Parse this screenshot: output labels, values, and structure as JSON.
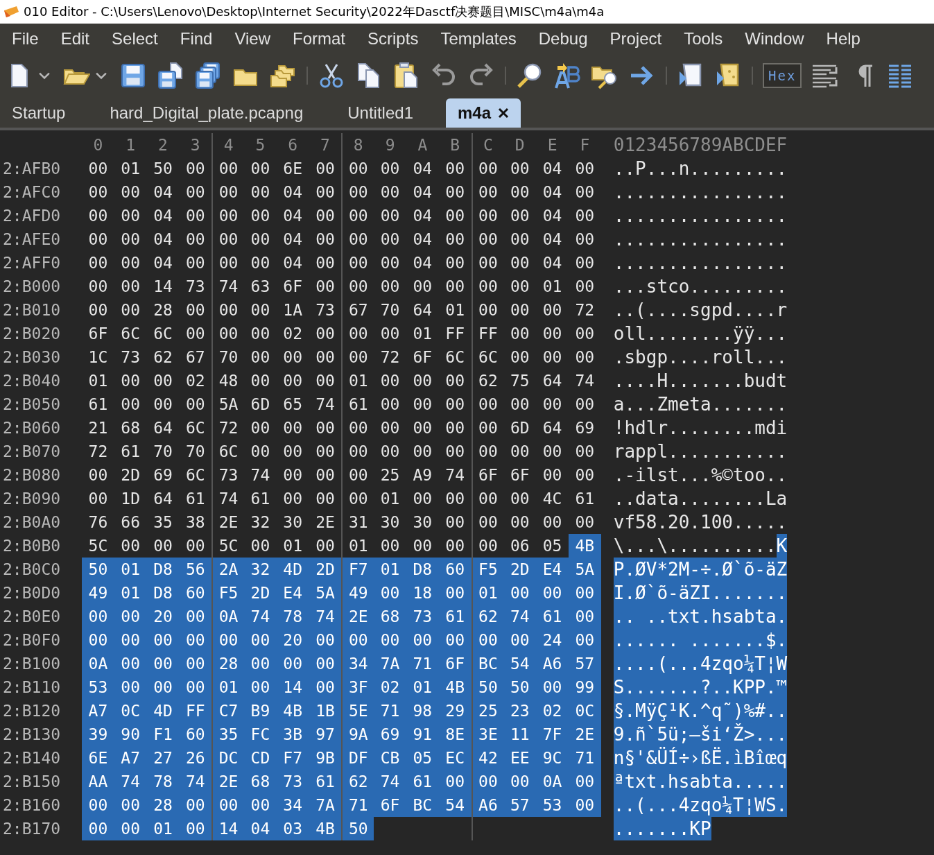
{
  "window": {
    "title": "010 Editor - C:\\Users\\Lenovo\\Desktop\\Internet Security\\2022年Dasctf决赛题目\\MISC\\m4a\\m4a"
  },
  "menu": [
    "File",
    "Edit",
    "Select",
    "Find",
    "View",
    "Format",
    "Scripts",
    "Templates",
    "Debug",
    "Project",
    "Tools",
    "Window",
    "Help"
  ],
  "toolbar": {
    "hex_toggle": {
      "label": "Hex",
      "on": true
    }
  },
  "tabs": [
    {
      "label": "Startup",
      "selected": false
    },
    {
      "label": "hard_Digital_plate.pcapng",
      "selected": false
    },
    {
      "label": "Untitled1",
      "selected": false
    },
    {
      "label": "m4a",
      "selected": true
    }
  ],
  "hex_view": {
    "column_headers": [
      "0",
      "1",
      "2",
      "3",
      "4",
      "5",
      "6",
      "7",
      "8",
      "9",
      "A",
      "B",
      "C",
      "D",
      "E",
      "F"
    ],
    "ascii_header": "0123456789ABCDEF",
    "rows": [
      {
        "address": "2:AFB0",
        "bytes": [
          "00",
          "01",
          "50",
          "00",
          "00",
          "00",
          "6E",
          "00",
          "00",
          "00",
          "04",
          "00",
          "00",
          "00",
          "04",
          "00"
        ],
        "selected_bytes": [],
        "ascii": "..P...n.........",
        "selected_ascii": ""
      },
      {
        "address": "2:AFC0",
        "bytes": [
          "00",
          "00",
          "04",
          "00",
          "00",
          "00",
          "04",
          "00",
          "00",
          "00",
          "04",
          "00",
          "00",
          "00",
          "04",
          "00"
        ],
        "selected_bytes": [],
        "ascii": "................",
        "selected_ascii": ""
      },
      {
        "address": "2:AFD0",
        "bytes": [
          "00",
          "00",
          "04",
          "00",
          "00",
          "00",
          "04",
          "00",
          "00",
          "00",
          "04",
          "00",
          "00",
          "00",
          "04",
          "00"
        ],
        "selected_bytes": [],
        "ascii": "................",
        "selected_ascii": ""
      },
      {
        "address": "2:AFE0",
        "bytes": [
          "00",
          "00",
          "04",
          "00",
          "00",
          "00",
          "04",
          "00",
          "00",
          "00",
          "04",
          "00",
          "00",
          "00",
          "04",
          "00"
        ],
        "selected_bytes": [],
        "ascii": "................",
        "selected_ascii": ""
      },
      {
        "address": "2:AFF0",
        "bytes": [
          "00",
          "00",
          "04",
          "00",
          "00",
          "00",
          "04",
          "00",
          "00",
          "00",
          "04",
          "00",
          "00",
          "00",
          "04",
          "00"
        ],
        "selected_bytes": [],
        "ascii": "................",
        "selected_ascii": ""
      },
      {
        "address": "2:B000",
        "bytes": [
          "00",
          "00",
          "14",
          "73",
          "74",
          "63",
          "6F",
          "00",
          "00",
          "00",
          "00",
          "00",
          "00",
          "00",
          "01",
          "00"
        ],
        "selected_bytes": [],
        "ascii": "...stco.........",
        "selected_ascii": ""
      },
      {
        "address": "2:B010",
        "bytes": [
          "00",
          "00",
          "28",
          "00",
          "00",
          "00",
          "1A",
          "73",
          "67",
          "70",
          "64",
          "01",
          "00",
          "00",
          "00",
          "72"
        ],
        "selected_bytes": [],
        "ascii": "..(....sgpd....r",
        "selected_ascii": ""
      },
      {
        "address": "2:B020",
        "bytes": [
          "6F",
          "6C",
          "6C",
          "00",
          "00",
          "00",
          "02",
          "00",
          "00",
          "00",
          "01",
          "FF",
          "FF",
          "00",
          "00",
          "00"
        ],
        "selected_bytes": [],
        "ascii": "oll........ÿÿ...",
        "selected_ascii": ""
      },
      {
        "address": "2:B030",
        "bytes": [
          "1C",
          "73",
          "62",
          "67",
          "70",
          "00",
          "00",
          "00",
          "00",
          "72",
          "6F",
          "6C",
          "6C",
          "00",
          "00",
          "00"
        ],
        "selected_bytes": [],
        "ascii": ".sbgp....roll...",
        "selected_ascii": ""
      },
      {
        "address": "2:B040",
        "bytes": [
          "01",
          "00",
          "00",
          "02",
          "48",
          "00",
          "00",
          "00",
          "01",
          "00",
          "00",
          "00",
          "62",
          "75",
          "64",
          "74"
        ],
        "selected_bytes": [],
        "ascii": "....H.......budt",
        "selected_ascii": ""
      },
      {
        "address": "2:B050",
        "bytes": [
          "61",
          "00",
          "00",
          "00",
          "5A",
          "6D",
          "65",
          "74",
          "61",
          "00",
          "00",
          "00",
          "00",
          "00",
          "00",
          "00"
        ],
        "selected_bytes": [],
        "ascii": "a...Zmeta.......",
        "selected_ascii": ""
      },
      {
        "address": "2:B060",
        "bytes": [
          "21",
          "68",
          "64",
          "6C",
          "72",
          "00",
          "00",
          "00",
          "00",
          "00",
          "00",
          "00",
          "00",
          "6D",
          "64",
          "69"
        ],
        "selected_bytes": [],
        "ascii": "!hdlr........mdi",
        "selected_ascii": ""
      },
      {
        "address": "2:B070",
        "bytes": [
          "72",
          "61",
          "70",
          "70",
          "6C",
          "00",
          "00",
          "00",
          "00",
          "00",
          "00",
          "00",
          "00",
          "00",
          "00",
          "00"
        ],
        "selected_bytes": [],
        "ascii": "rappl...........",
        "selected_ascii": ""
      },
      {
        "address": "2:B080",
        "bytes": [
          "00",
          "2D",
          "69",
          "6C",
          "73",
          "74",
          "00",
          "00",
          "00",
          "25",
          "A9",
          "74",
          "6F",
          "6F",
          "00",
          "00"
        ],
        "selected_bytes": [],
        "ascii": ".-ilst...%©too..",
        "selected_ascii": ""
      },
      {
        "address": "2:B090",
        "bytes": [
          "00",
          "1D",
          "64",
          "61",
          "74",
          "61",
          "00",
          "00",
          "00",
          "01",
          "00",
          "00",
          "00",
          "00",
          "4C",
          "61"
        ],
        "selected_bytes": [],
        "ascii": "..data........La",
        "selected_ascii": ""
      },
      {
        "address": "2:B0A0",
        "bytes": [
          "76",
          "66",
          "35",
          "38",
          "2E",
          "32",
          "30",
          "2E",
          "31",
          "30",
          "30",
          "00",
          "00",
          "00",
          "00",
          "00"
        ],
        "selected_bytes": [],
        "ascii": "vf58.20.100.....",
        "selected_ascii": ""
      },
      {
        "address": "2:B0B0",
        "bytes": [
          "5C",
          "00",
          "00",
          "00",
          "5C",
          "00",
          "01",
          "00",
          "01",
          "00",
          "00",
          "00",
          "00",
          "06",
          "05"
        ],
        "selected_bytes": [
          "4B"
        ],
        "ascii": "\\...\\..........",
        "selected_ascii": "K"
      },
      {
        "address": "2:B0C0",
        "bytes": [],
        "selected_bytes": [
          "50",
          "01",
          "D8",
          "56",
          "2A",
          "32",
          "4D",
          "2D",
          "F7",
          "01",
          "D8",
          "60",
          "F5",
          "2D",
          "E4",
          "5A"
        ],
        "ascii": "",
        "selected_ascii": "P.ØV*2M-÷.Ø`õ-äZ"
      },
      {
        "address": "2:B0D0",
        "bytes": [],
        "selected_bytes": [
          "49",
          "01",
          "D8",
          "60",
          "F5",
          "2D",
          "E4",
          "5A",
          "49",
          "00",
          "18",
          "00",
          "01",
          "00",
          "00",
          "00"
        ],
        "ascii": "",
        "selected_ascii": "I.Ø`õ-äZI......."
      },
      {
        "address": "2:B0E0",
        "bytes": [],
        "selected_bytes": [
          "00",
          "00",
          "20",
          "00",
          "0A",
          "74",
          "78",
          "74",
          "2E",
          "68",
          "73",
          "61",
          "62",
          "74",
          "61",
          "00"
        ],
        "ascii": "",
        "selected_ascii": ".. ..txt.hsabta."
      },
      {
        "address": "2:B0F0",
        "bytes": [],
        "selected_bytes": [
          "00",
          "00",
          "00",
          "00",
          "00",
          "00",
          "20",
          "00",
          "00",
          "00",
          "00",
          "00",
          "00",
          "00",
          "24",
          "00"
        ],
        "ascii": "",
        "selected_ascii": "...... .......$."
      },
      {
        "address": "2:B100",
        "bytes": [],
        "selected_bytes": [
          "0A",
          "00",
          "00",
          "00",
          "28",
          "00",
          "00",
          "00",
          "34",
          "7A",
          "71",
          "6F",
          "BC",
          "54",
          "A6",
          "57"
        ],
        "ascii": "",
        "selected_ascii": "....(...4zqo¼T¦W"
      },
      {
        "address": "2:B110",
        "bytes": [],
        "selected_bytes": [
          "53",
          "00",
          "00",
          "00",
          "01",
          "00",
          "14",
          "00",
          "3F",
          "02",
          "01",
          "4B",
          "50",
          "50",
          "00",
          "99"
        ],
        "ascii": "",
        "selected_ascii": "S.......?..KPP.™"
      },
      {
        "address": "2:B120",
        "bytes": [],
        "selected_bytes": [
          "A7",
          "0C",
          "4D",
          "FF",
          "C7",
          "B9",
          "4B",
          "1B",
          "5E",
          "71",
          "98",
          "29",
          "25",
          "23",
          "02",
          "0C"
        ],
        "ascii": "",
        "selected_ascii": "§.MÿÇ¹K.^q˜)%#.."
      },
      {
        "address": "2:B130",
        "bytes": [],
        "selected_bytes": [
          "39",
          "90",
          "F1",
          "60",
          "35",
          "FC",
          "3B",
          "97",
          "9A",
          "69",
          "91",
          "8E",
          "3E",
          "11",
          "7F",
          "2E"
        ],
        "ascii": "",
        "selected_ascii": "9.ñ`5ü;—ši‘Ž>..."
      },
      {
        "address": "2:B140",
        "bytes": [],
        "selected_bytes": [
          "6E",
          "A7",
          "27",
          "26",
          "DC",
          "CD",
          "F7",
          "9B",
          "DF",
          "CB",
          "05",
          "EC",
          "42",
          "EE",
          "9C",
          "71"
        ],
        "ascii": "",
        "selected_ascii": "n§'&ÜÍ÷›ßË.ìBîœq"
      },
      {
        "address": "2:B150",
        "bytes": [],
        "selected_bytes": [
          "AA",
          "74",
          "78",
          "74",
          "2E",
          "68",
          "73",
          "61",
          "62",
          "74",
          "61",
          "00",
          "00",
          "00",
          "0A",
          "00"
        ],
        "ascii": "",
        "selected_ascii": "ªtxt.hsabta....."
      },
      {
        "address": "2:B160",
        "bytes": [],
        "selected_bytes": [
          "00",
          "00",
          "28",
          "00",
          "00",
          "00",
          "34",
          "7A",
          "71",
          "6F",
          "BC",
          "54",
          "A6",
          "57",
          "53",
          "00"
        ],
        "ascii": "",
        "selected_ascii": "..(...4zqo¼T¦WS."
      },
      {
        "address": "2:B170",
        "bytes": [],
        "selected_bytes": [
          "00",
          "00",
          "01",
          "00",
          "14",
          "04",
          "03",
          "4B",
          "50"
        ],
        "ascii": "",
        "selected_ascii": ".......KP"
      }
    ]
  }
}
